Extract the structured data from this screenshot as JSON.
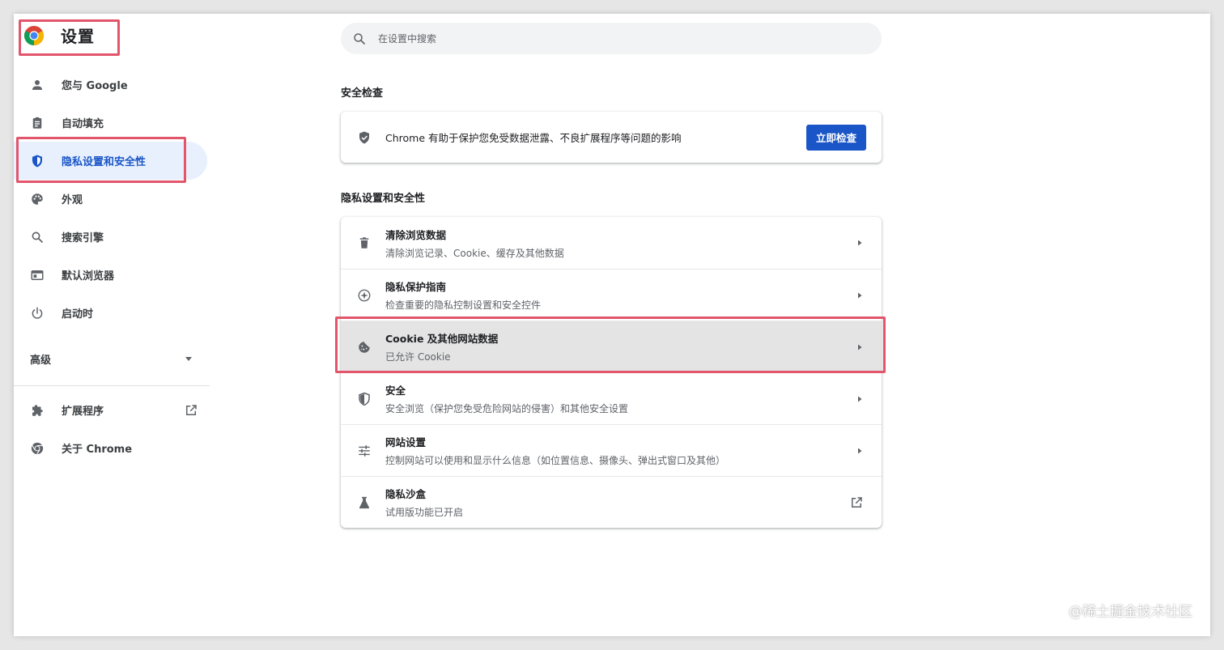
{
  "header": {
    "title": "设置"
  },
  "search": {
    "placeholder": "在设置中搜索"
  },
  "sidebar": {
    "items": [
      {
        "label": "您与 Google",
        "icon": "person-icon"
      },
      {
        "label": "自动填充",
        "icon": "clipboard-icon"
      },
      {
        "label": "隐私设置和安全性",
        "icon": "shield-icon",
        "active": true
      },
      {
        "label": "外观",
        "icon": "palette-icon"
      },
      {
        "label": "搜索引擎",
        "icon": "search-icon"
      },
      {
        "label": "默认浏览器",
        "icon": "browser-window-icon"
      },
      {
        "label": "启动时",
        "icon": "power-icon"
      }
    ],
    "advanced_label": "高级",
    "extensions_label": "扩展程序",
    "about_label": "关于 Chrome"
  },
  "safety_check": {
    "title": "安全检查",
    "description": "Chrome 有助于保护您免受数据泄露、不良扩展程序等问题的影响",
    "button": "立即检查"
  },
  "privacy": {
    "title": "隐私设置和安全性",
    "rows": [
      {
        "title": "清除浏览数据",
        "subtitle": "清除浏览记录、Cookie、缓存及其他数据",
        "icon": "trash-icon"
      },
      {
        "title": "隐私保护指南",
        "subtitle": "检查重要的隐私控制设置和安全控件",
        "icon": "compass-icon"
      },
      {
        "title": "Cookie 及其他网站数据",
        "subtitle": "已允许 Cookie",
        "icon": "cookie-icon"
      },
      {
        "title": "安全",
        "subtitle": "安全浏览（保护您免受危险网站的侵害）和其他安全设置",
        "icon": "security-shield-icon"
      },
      {
        "title": "网站设置",
        "subtitle": "控制网站可以使用和显示什么信息（如位置信息、摄像头、弹出式窗口及其他）",
        "icon": "tune-icon"
      },
      {
        "title": "隐私沙盒",
        "subtitle": "试用版功能已开启",
        "icon": "flask-icon"
      }
    ]
  },
  "watermark": "@稀土掘金技术社区",
  "colors": {
    "accent": "#1a56c7",
    "highlight": "#e2556b",
    "active_bg": "#e8f0fe"
  }
}
